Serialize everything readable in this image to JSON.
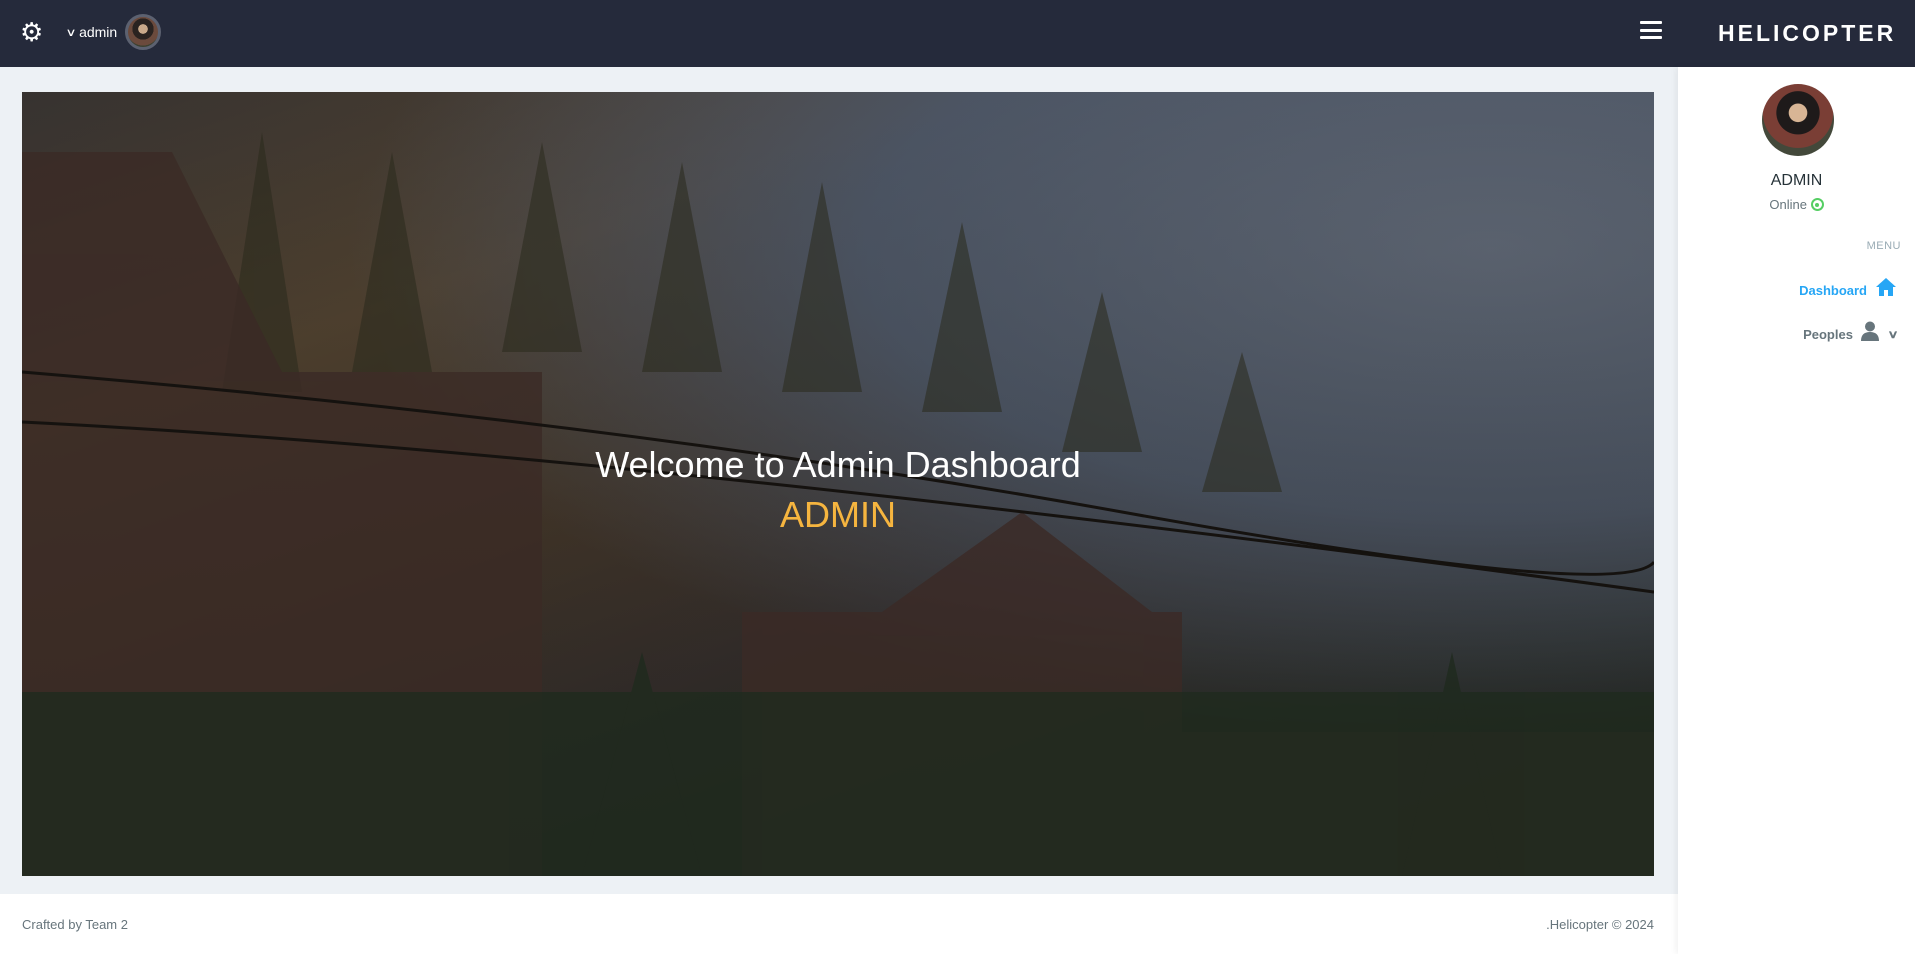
{
  "header": {
    "username": "admin",
    "logo": "HELICOPTER",
    "settings_icon": "gear-icon",
    "menu_icon": "hamburger-icon"
  },
  "banner": {
    "welcome": "Welcome to Admin Dashboard",
    "name": "ADMIN",
    "name_color": "#f6b53f"
  },
  "sidebar": {
    "name": "ADMIN",
    "status": "Online",
    "status_color": "#55ce63",
    "menu_caption": "MENU",
    "items": [
      {
        "label": "Dashboard",
        "icon": "home-icon",
        "active": true
      },
      {
        "label": "Peoples",
        "icon": "user-icon",
        "expandable": true
      }
    ]
  },
  "footer": {
    "left": "Crafted by Team 2",
    "right": ".Helicopter © 2024"
  }
}
